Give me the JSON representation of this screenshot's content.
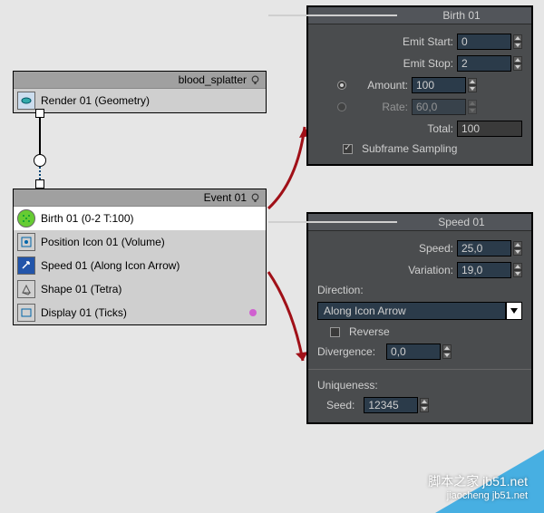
{
  "blood_node": {
    "title": "blood_splatter",
    "render": "Render 01 (Geometry)"
  },
  "event_node": {
    "title": "Event 01",
    "ops": [
      {
        "label": "Birth 01 (0-2 T:100)",
        "selected": true
      },
      {
        "label": "Position Icon 01 (Volume)"
      },
      {
        "label": "Speed 01 (Along Icon Arrow)"
      },
      {
        "label": "Shape 01 (Tetra)"
      },
      {
        "label": "Display 01 (Ticks)"
      }
    ]
  },
  "birth_panel": {
    "title": "Birth 01",
    "emit_start_label": "Emit Start:",
    "emit_start": "0",
    "emit_stop_label": "Emit Stop:",
    "emit_stop": "2",
    "amount_label": "Amount:",
    "amount": "100",
    "rate_label": "Rate:",
    "rate": "60,0",
    "total_label": "Total:",
    "total": "100",
    "subframe_label": "Subframe Sampling"
  },
  "speed_panel": {
    "title": "Speed 01",
    "speed_label": "Speed:",
    "speed": "25,0",
    "variation_label": "Variation:",
    "variation": "19,0",
    "direction_label": "Direction:",
    "direction_value": "Along Icon Arrow",
    "reverse_label": "Reverse",
    "divergence_label": "Divergence:",
    "divergence": "0,0",
    "uniqueness_label": "Uniqueness:",
    "seed_label": "Seed:",
    "seed": "12345"
  },
  "watermark": {
    "line1": "脚本之家 jb51.net",
    "line2": "jiaocheng jb51.net"
  }
}
